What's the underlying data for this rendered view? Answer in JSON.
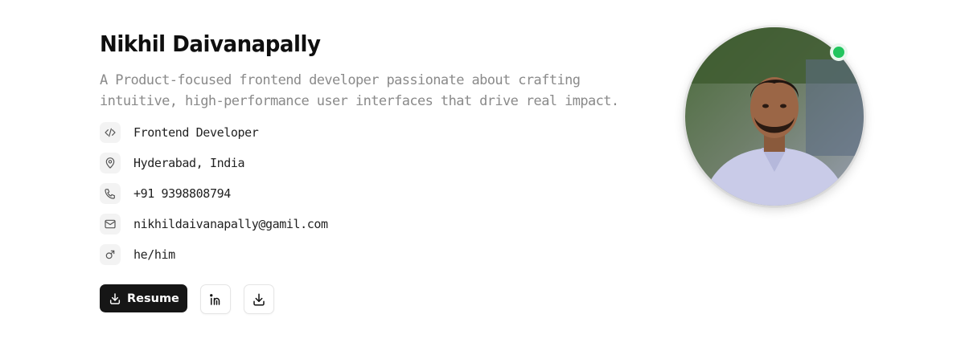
{
  "profile": {
    "name": "Nikhil Daivanapally",
    "bio": "A Product-focused frontend developer passionate about crafting intuitive, high-performance user interfaces that drive real impact."
  },
  "details": [
    {
      "icon": "code-icon",
      "text": "Frontend Developer"
    },
    {
      "icon": "map-pin-icon",
      "text": "Hyderabad, India"
    },
    {
      "icon": "phone-icon",
      "text": "+91 9398808794"
    },
    {
      "icon": "mail-icon",
      "text": "nikhildaivanapally@gamil.com"
    },
    {
      "icon": "male-gender-icon",
      "text": "he/him"
    }
  ],
  "actions": {
    "resume_label": "Resume",
    "linkedin_icon": "linkedin-icon",
    "download_icon": "download-icon"
  },
  "avatar": {
    "status": "online",
    "status_color": "#22c55e"
  },
  "colors": {
    "text_primary": "#0f0f0f",
    "text_muted": "#8a8a8a",
    "button_dark": "#161616"
  }
}
